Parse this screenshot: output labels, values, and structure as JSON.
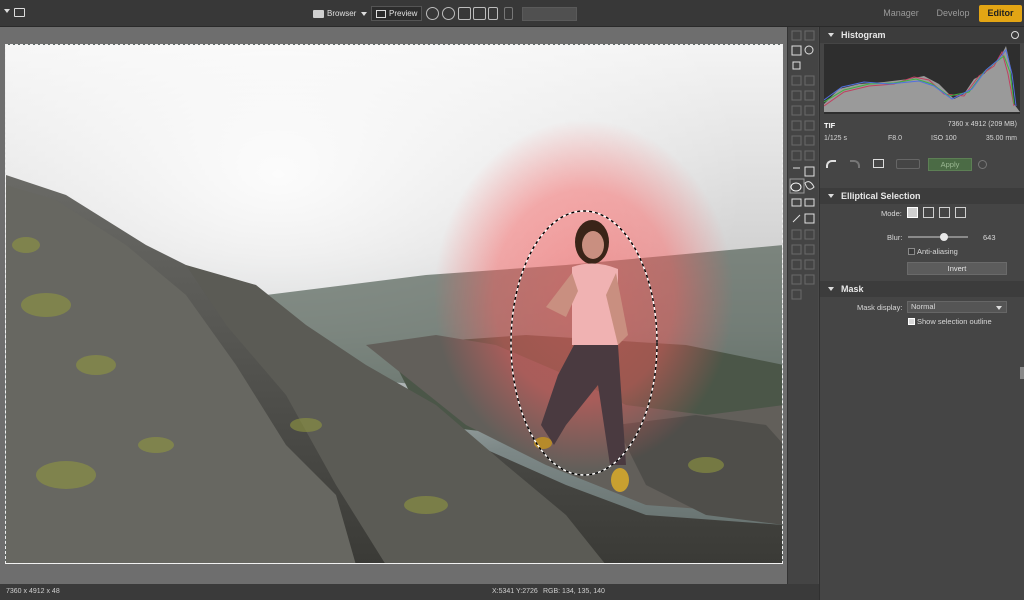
{
  "topbar": {
    "browser_label": "Browser",
    "preview_label": "Preview",
    "tabs": [
      "Manager",
      "Develop",
      "Editor"
    ]
  },
  "histogram": {
    "title": "Histogram",
    "file_type": "TIF",
    "dimensions": "7360 x 4912 (209 MB)",
    "shutter": "1/125 s",
    "aperture": "F8.0",
    "iso": "ISO 100",
    "focal": "35.00 mm"
  },
  "history": {
    "apply_label": "Apply"
  },
  "elliptical": {
    "title": "Elliptical Selection",
    "mode_label": "Mode:",
    "blur_label": "Blur:",
    "blur_value": "643",
    "blur_fraction": 0.6,
    "antialias_label": "Anti-aliasing",
    "invert_label": "Invert"
  },
  "mask": {
    "title": "Mask",
    "display_label": "Mask display:",
    "display_value": "Normal",
    "outline_label": "Show selection outline"
  },
  "status": {
    "image_info": "7360 x 4912 x 48",
    "coords": "X:5341 Y:2726",
    "rgb": "RGB: 134, 135, 140"
  },
  "colors": {
    "accent": "#e3a514",
    "mask_overlay": "#ff5a5a"
  }
}
